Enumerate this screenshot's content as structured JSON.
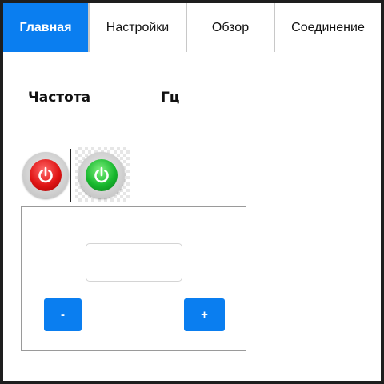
{
  "tabs": [
    {
      "label": "Главная",
      "active": true
    },
    {
      "label": "Настройки",
      "active": false
    },
    {
      "label": "Обзор",
      "active": false
    },
    {
      "label": "Соединение",
      "active": false
    }
  ],
  "frequency": {
    "label": "Частота",
    "value": "",
    "unit": "Гц"
  },
  "power": {
    "off_icon": "power-off-icon",
    "on_icon": "power-on-icon",
    "off_color": "#e01515",
    "on_color": "#18b82e"
  },
  "control": {
    "value": "",
    "minus_label": "-",
    "plus_label": "+"
  },
  "colors": {
    "accent": "#0a7ef0"
  }
}
